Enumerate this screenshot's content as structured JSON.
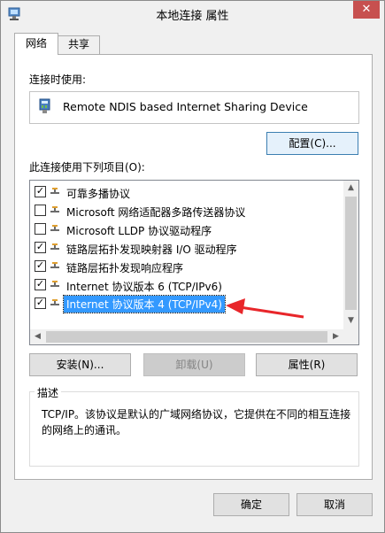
{
  "window": {
    "title": "本地连接 属性",
    "close_label": "✕"
  },
  "tabs": [
    {
      "label": "网络"
    },
    {
      "label": "共享"
    }
  ],
  "connect_using_label": "连接时使用:",
  "device_name": "Remote NDIS based Internet Sharing Device",
  "configure_label": "配置(C)...",
  "items_label": "此连接使用下列项目(O):",
  "items": [
    {
      "label": "可靠多播协议",
      "checked": true,
      "icon": "protocol-icon"
    },
    {
      "label": "Microsoft 网络适配器多路传送器协议",
      "checked": false,
      "icon": "protocol-icon"
    },
    {
      "label": "Microsoft LLDP 协议驱动程序",
      "checked": false,
      "icon": "protocol-icon"
    },
    {
      "label": "链路层拓扑发现映射器 I/O 驱动程序",
      "checked": true,
      "icon": "protocol-icon"
    },
    {
      "label": "链路层拓扑发现响应程序",
      "checked": true,
      "icon": "protocol-icon"
    },
    {
      "label": "Internet 协议版本 6 (TCP/IPv6)",
      "checked": true,
      "icon": "protocol-icon"
    },
    {
      "label": "Internet 协议版本 4 (TCP/IPv4)",
      "checked": true,
      "icon": "protocol-icon",
      "selected": true
    }
  ],
  "buttons": {
    "install": "安装(N)...",
    "uninstall": "卸载(U)",
    "properties": "属性(R)"
  },
  "description": {
    "legend": "描述",
    "text": "TCP/IP。该协议是默认的广域网络协议，它提供在不同的相互连接的网络上的通讯。"
  },
  "footer": {
    "ok": "确定",
    "cancel": "取消"
  },
  "colors": {
    "selection": "#3399ff",
    "close": "#c7504f",
    "annotation_arrow": "#e8262a"
  }
}
